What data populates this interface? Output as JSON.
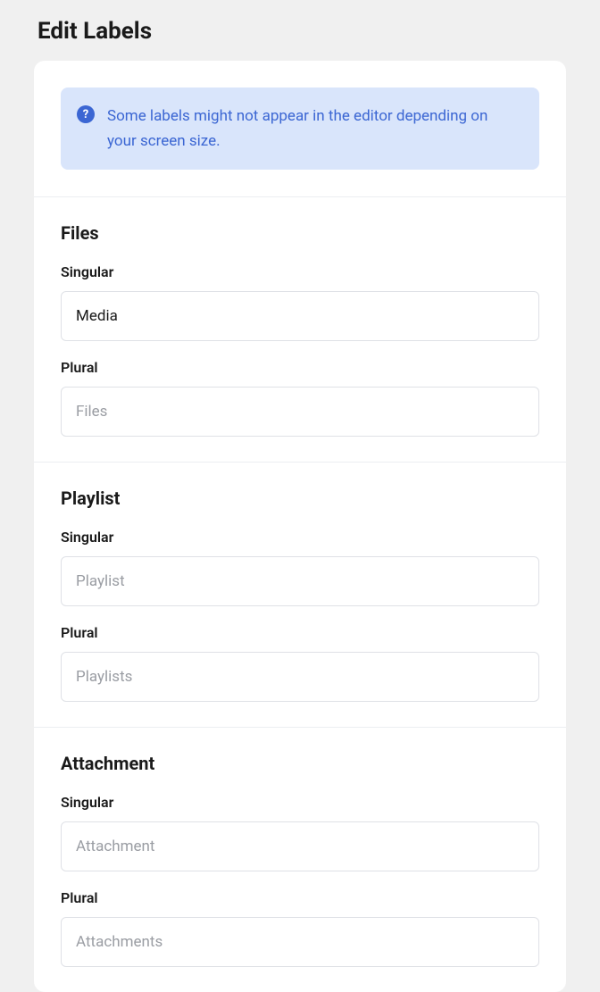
{
  "page": {
    "title": "Edit Labels"
  },
  "info": {
    "text": "Some labels might not appear in the editor depending on your screen size."
  },
  "sections": [
    {
      "title": "Files",
      "singular_label": "Singular",
      "singular_value": "Media",
      "singular_placeholder": "",
      "plural_label": "Plural",
      "plural_value": "",
      "plural_placeholder": "Files"
    },
    {
      "title": "Playlist",
      "singular_label": "Singular",
      "singular_value": "",
      "singular_placeholder": "Playlist",
      "plural_label": "Plural",
      "plural_value": "",
      "plural_placeholder": "Playlists"
    },
    {
      "title": "Attachment",
      "singular_label": "Singular",
      "singular_value": "",
      "singular_placeholder": "Attachment",
      "plural_label": "Plural",
      "plural_value": "",
      "plural_placeholder": "Attachments"
    }
  ]
}
